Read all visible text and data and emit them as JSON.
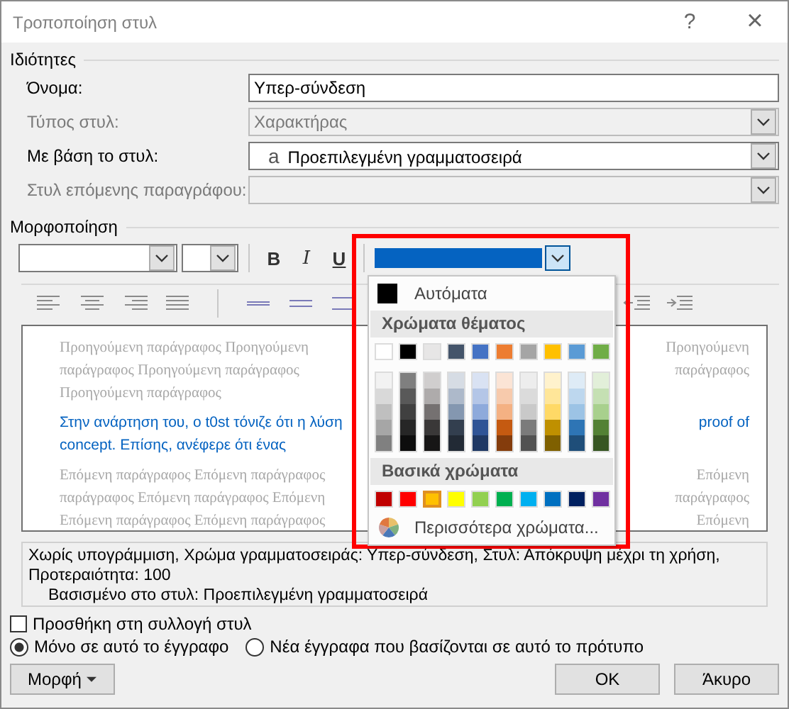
{
  "window": {
    "title": "Τροποποίηση στυλ",
    "help": "?",
    "close": "×"
  },
  "properties": {
    "heading": "Ιδιότητες",
    "fields": [
      {
        "label": "Όνομα:",
        "value": "Υπερ-σύνδεση",
        "kind": "text",
        "disabled": false
      },
      {
        "label": "Τύπος στυλ:",
        "value": "Χαρακτήρας",
        "kind": "combo",
        "disabled": true
      },
      {
        "label": "Με βάση το στυλ:",
        "glyph": "a",
        "value": "Προεπιλεγμένη γραμματοσειρά",
        "kind": "combo",
        "disabled": false
      },
      {
        "label": "Στυλ επόμενης παραγράφου:",
        "kind": "combo",
        "disabled": true
      }
    ]
  },
  "formatting": {
    "heading": "Μορφοποίηση",
    "bold": "B",
    "italic": "I",
    "underline": "U",
    "font_color": {
      "color": "#0563c1",
      "expanded": true
    }
  },
  "color_menu": {
    "automatic": "Αυτόματα",
    "theme_heading": "Χρώματα θέματος",
    "theme_colors": [
      {
        "color": "#ffffff",
        "shades": [
          {
            "color": "#f2f2f2"
          },
          {
            "color": "#d9d9d9"
          },
          {
            "color": "#bfbfbf"
          },
          {
            "color": "#a6a6a6"
          },
          {
            "color": "#808080"
          }
        ]
      },
      {
        "color": "#000000",
        "shades": [
          {
            "color": "#7f7f7f"
          },
          {
            "color": "#595959"
          },
          {
            "color": "#404040"
          },
          {
            "color": "#262626"
          },
          {
            "color": "#0d0d0d"
          }
        ]
      },
      {
        "color": "#e7e6e6",
        "shades": [
          {
            "color": "#d0cece"
          },
          {
            "color": "#aeabab"
          },
          {
            "color": "#757171"
          },
          {
            "color": "#3a3838"
          },
          {
            "color": "#171616"
          }
        ]
      },
      {
        "color": "#44546a",
        "shades": [
          {
            "color": "#d6dce4"
          },
          {
            "color": "#adb9ca"
          },
          {
            "color": "#8497b0"
          },
          {
            "color": "#333f4f"
          },
          {
            "color": "#222a35"
          }
        ]
      },
      {
        "color": "#4472c4",
        "shades": [
          {
            "color": "#d9e2f3"
          },
          {
            "color": "#b4c6e7"
          },
          {
            "color": "#8eaadb"
          },
          {
            "color": "#2f5496"
          },
          {
            "color": "#1f3864"
          }
        ]
      },
      {
        "color": "#ed7d31",
        "shades": [
          {
            "color": "#fbe4d5"
          },
          {
            "color": "#f7caac"
          },
          {
            "color": "#f4b183"
          },
          {
            "color": "#c55a11"
          },
          {
            "color": "#843c0c"
          }
        ]
      },
      {
        "color": "#a5a5a5",
        "shades": [
          {
            "color": "#ededed"
          },
          {
            "color": "#dbdbdb"
          },
          {
            "color": "#c9c9c9"
          },
          {
            "color": "#7b7b7b"
          },
          {
            "color": "#525252"
          }
        ]
      },
      {
        "color": "#ffc000",
        "shades": [
          {
            "color": "#fff2cc"
          },
          {
            "color": "#ffe699"
          },
          {
            "color": "#ffd966"
          },
          {
            "color": "#bf9000"
          },
          {
            "color": "#7f6000"
          }
        ]
      },
      {
        "color": "#5b9bd5",
        "shades": [
          {
            "color": "#deebf6"
          },
          {
            "color": "#bdd7ee"
          },
          {
            "color": "#9cc3e5"
          },
          {
            "color": "#2e75b5"
          },
          {
            "color": "#1f4e79"
          }
        ]
      },
      {
        "color": "#70ad47",
        "shades": [
          {
            "color": "#e2efd9"
          },
          {
            "color": "#c5e0b3"
          },
          {
            "color": "#a8d08d"
          },
          {
            "color": "#538135"
          },
          {
            "color": "#375623"
          }
        ]
      }
    ],
    "standard_heading": "Βασικά χρώματα",
    "standard_colors": [
      {
        "color": "#c00000",
        "selected": false
      },
      {
        "color": "#ff0000",
        "selected": false
      },
      {
        "color": "#ffc000",
        "selected": true
      },
      {
        "color": "#ffff00",
        "selected": false
      },
      {
        "color": "#92d050",
        "selected": false
      },
      {
        "color": "#00b050",
        "selected": false
      },
      {
        "color": "#00b0f0",
        "selected": false
      },
      {
        "color": "#0070c0",
        "selected": false
      },
      {
        "color": "#002060",
        "selected": false
      },
      {
        "color": "#7030a0",
        "selected": false
      }
    ],
    "more": "Περισσότερα χρώματα..."
  },
  "preview": {
    "lines": [
      {
        "kind": "context",
        "left": "Προηγούμενη παράγραφος Προηγούμενη",
        "right": "Προηγούμενη"
      },
      {
        "kind": "context",
        "left": "παράγραφος Προηγούμενη παράγραφος",
        "right": "παράγραφος"
      },
      {
        "kind": "context",
        "left": "Προηγούμενη παράγραφος"
      },
      {
        "kind": "sample",
        "left": "Στην ανάρτηση του, ο t0st τόνιζε ότι η λύση",
        "right": "proof of"
      },
      {
        "kind": "sample",
        "left": "concept. Επίσης, ανέφερε ότι ένας"
      },
      {
        "kind": "context",
        "left": "Επόμενη παράγραφος Επόμενη παράγραφος",
        "right": "Επόμενη"
      },
      {
        "kind": "context",
        "left": "παράγραφος Επόμενη παράγραφος Επόμενη",
        "right": "παράγραφος"
      },
      {
        "kind": "context",
        "left": "Επόμενη παράγραφος Επόμενη παράγραφος",
        "right": "Επόμενη"
      }
    ]
  },
  "description": [
    {
      "kind": "plain",
      "text": "Χωρίς υπογράμμιση, Χρώμα γραμματοσειράς: Υπερ-σύνδεση, Στυλ: Απόκρυψη μέχρι τη χρήση,"
    },
    {
      "kind": "plain",
      "text": "Προτεραιότητα: 100"
    },
    {
      "kind": "indent",
      "text": "Βασισμένο στο στυλ: Προεπιλεγμένη γραμματοσειρά"
    }
  ],
  "add_to_gallery": {
    "label": "Προσθήκη στη συλλογή στυλ",
    "checked": false
  },
  "scope": [
    {
      "label": "Μόνο σε αυτό το έγγραφο",
      "selected": true
    },
    {
      "label": "Νέα έγγραφα που βασίζονται σε αυτό το πρότυπο",
      "selected": false
    }
  ],
  "buttons": {
    "format": "Μορφή",
    "ok": "OK",
    "cancel": "Άκυρο"
  }
}
